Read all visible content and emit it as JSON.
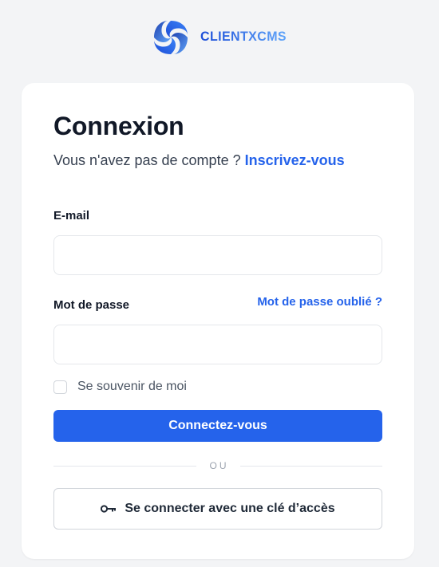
{
  "brand": {
    "name": "CLIENTXCMS",
    "logo_icon": "clientxcms-swirl-logo",
    "gradient": [
      "#1d4ed8",
      "#60a5fa"
    ]
  },
  "login": {
    "title": "Connexion",
    "no_account_text": "Vous n'avez pas de compte ?",
    "register_link": "Inscrivez-vous",
    "email_label": "E-mail",
    "email_value": "",
    "email_placeholder": "",
    "password_label": "Mot de passe",
    "password_value": "",
    "password_placeholder": "",
    "forgot_link": "Mot de passe oublié ?",
    "remember_label": "Se souvenir de moi",
    "remember_checked": false,
    "submit_label": "Connectez-vous",
    "divider_text": "OU",
    "passkey_label": "Se connecter avec une clé d’accès",
    "passkey_icon": "key-icon"
  },
  "colors": {
    "accent": "#2563eb",
    "background": "#f3f4f6",
    "card": "#ffffff"
  }
}
